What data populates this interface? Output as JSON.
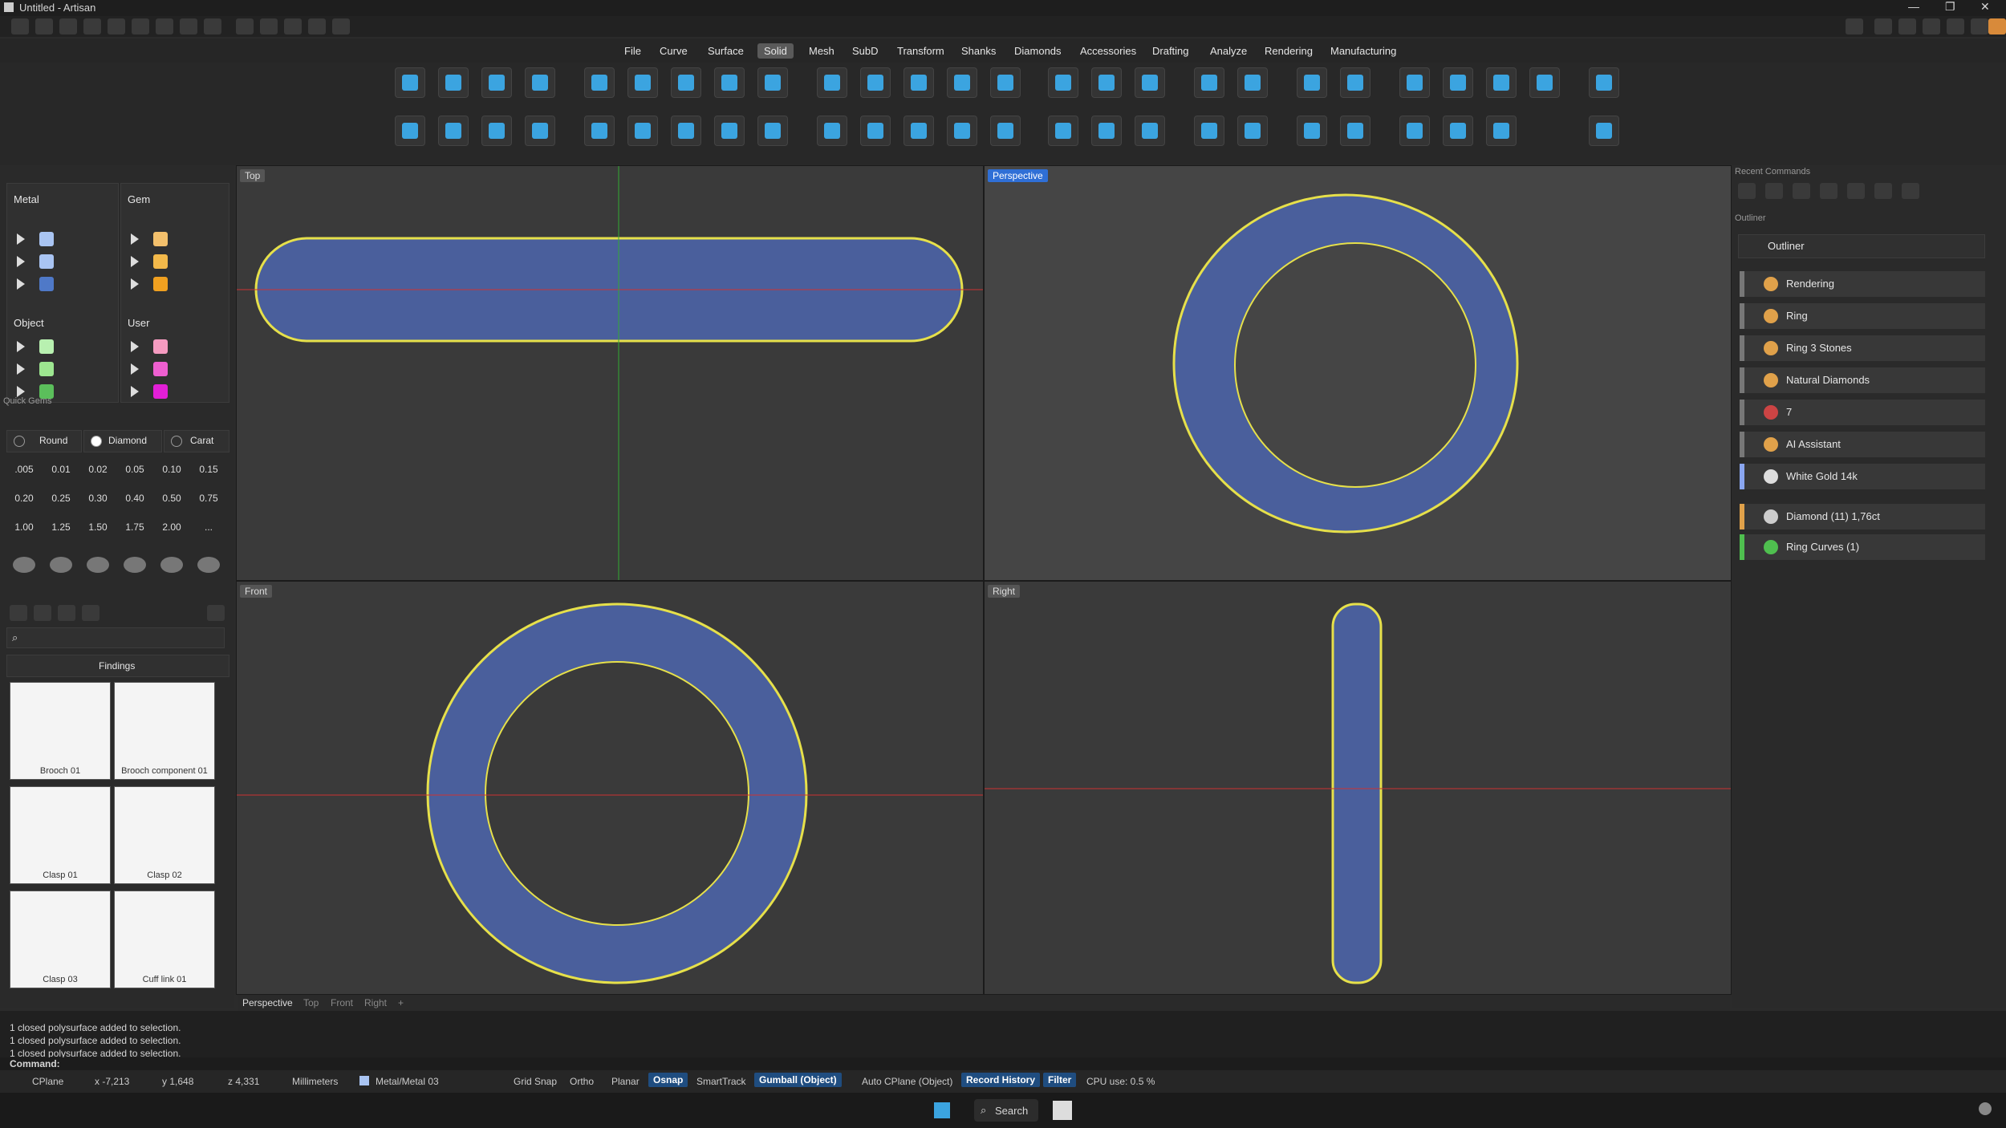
{
  "window": {
    "title": "Untitled - Artisan"
  },
  "menu": {
    "items": [
      "File",
      "Curve",
      "Surface",
      "Solid",
      "Mesh",
      "SubD",
      "Transform",
      "Shanks",
      "Diamonds",
      "Accessories",
      "Drafting",
      "Analyze",
      "Rendering",
      "Manufacturing"
    ],
    "active": "Solid"
  },
  "layers": {
    "metal_label": "Metal",
    "gem_label": "Gem",
    "object_label": "Object",
    "user_label": "User",
    "metal_colors": [
      "#a9c4f2",
      "#a9c4f2",
      "#4f79c8"
    ],
    "gem_colors": [
      "#f3c06c",
      "#f3b94a",
      "#f0a020"
    ],
    "object_colors": [
      "#b8f0b0",
      "#9de690",
      "#5bbf5b"
    ],
    "user_colors": [
      "#f59bc0",
      "#ee5fd0",
      "#e21fd6"
    ]
  },
  "quick_gems": {
    "title": "Quick Gems",
    "shape": "Round",
    "material": "Diamond",
    "unit": "Carat",
    "carats": [
      ".005",
      "0.01",
      "0.02",
      "0.05",
      "0.10",
      "0.15",
      "0.20",
      "0.25",
      "0.30",
      "0.40",
      "0.50",
      "0.75",
      "1.00",
      "1.25",
      "1.50",
      "1.75",
      "2.00",
      "..."
    ]
  },
  "library": {
    "category": "Findings",
    "items": [
      {
        "caption": "Brooch 01"
      },
      {
        "caption": "Brooch component 01"
      },
      {
        "caption": "Clasp 01"
      },
      {
        "caption": "Clasp 02"
      },
      {
        "caption": "Clasp 03"
      },
      {
        "caption": "Cuff link 01"
      }
    ]
  },
  "viewports": {
    "top": "Top",
    "perspective": "Perspective",
    "front": "Front",
    "right": "Right"
  },
  "view_tabs": [
    "Perspective",
    "Top",
    "Front",
    "Right"
  ],
  "view_tab_add": "+",
  "recent_commands": {
    "title": "Recent Commands"
  },
  "outliner": {
    "title": "Outliner",
    "header_label": "Outliner",
    "rows": [
      "Rendering",
      "Ring",
      "Ring 3 Stones",
      "Natural Diamonds",
      "7",
      "AI Assistant",
      "White Gold 14k"
    ],
    "objects": [
      {
        "label": "Diamond (11) 1,76ct",
        "color": "#e0a14a"
      },
      {
        "label": "Ring Curves (1)",
        "color": "#4fbf4f"
      }
    ]
  },
  "command_history": [
    "1 closed polysurface added to selection.",
    "1 closed polysurface added to selection.",
    "1 closed polysurface added to selection."
  ],
  "command_prompt": "Command:",
  "status": {
    "cplane": "CPlane",
    "x": "x -7,213",
    "y": "y 1,648",
    "z": "z 4,331",
    "units": "Millimeters",
    "layer": "Metal/Metal 03",
    "grid_snap": "Grid Snap",
    "ortho": "Ortho",
    "planar": "Planar",
    "osnap": "Osnap",
    "smarttrack": "SmartTrack",
    "gumball": "Gumball (Object)",
    "auto_cplane": "Auto CPlane (Object)",
    "record_history": "Record History",
    "filter": "Filter",
    "cpu": "CPU use: 0.5 %"
  },
  "taskbar": {
    "search": "Search"
  },
  "colors": {
    "accent": "#2f6fd6",
    "ring_blue": "#4a5f9c",
    "wire_yellow": "#e6e04a"
  }
}
